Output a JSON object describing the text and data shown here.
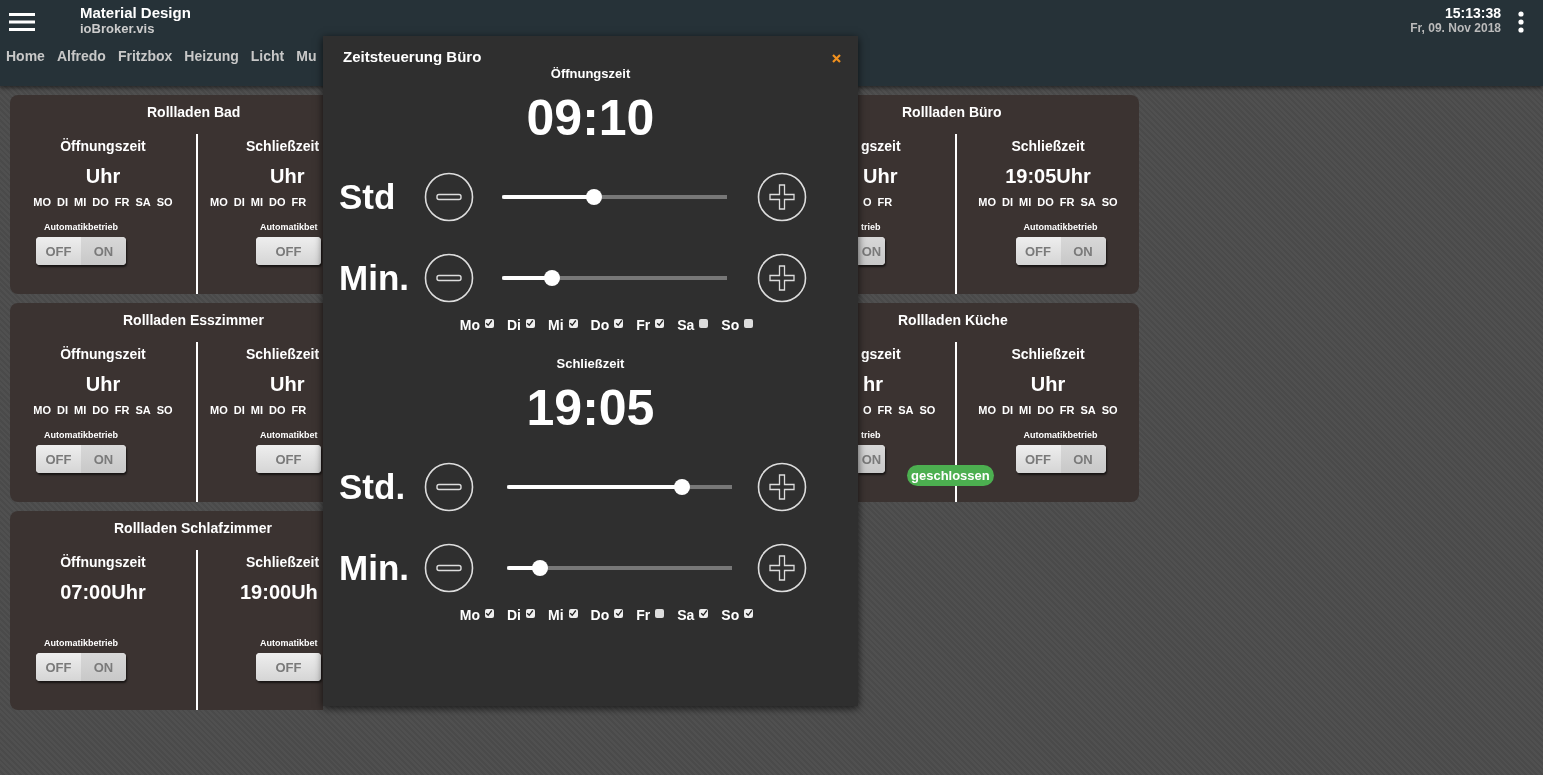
{
  "header": {
    "title": "Material Design",
    "subtitle": "ioBroker.vis",
    "time": "15:13:38",
    "date": "Fr, 09. Nov 2018",
    "nav": [
      {
        "label": "Home",
        "selected": false
      },
      {
        "label": "Alfredo",
        "selected": false
      },
      {
        "label": "Fritzbox",
        "selected": false
      },
      {
        "label": "Heizung",
        "selected": false
      },
      {
        "label": "Licht",
        "selected": false
      },
      {
        "label": "Mu",
        "selected": false
      }
    ]
  },
  "left_cards": [
    {
      "title": "Rollladen Bad",
      "halves": [
        {
          "label": "Öffnungszeit",
          "time": "Uhr",
          "days": [
            "MO",
            "DI",
            "MI",
            "DO",
            "FR",
            "SA",
            "SO"
          ],
          "auto_label": "Automatikbetrieb",
          "switch": [
            "OFF",
            "ON"
          ],
          "on": true
        },
        {
          "label": "Schließzeit",
          "time": "Uhr",
          "days": [
            "MO",
            "DI",
            "MI",
            "DO",
            "FR"
          ],
          "auto_label": "Automatikbet",
          "switch": [
            "OFF"
          ],
          "on": true
        }
      ]
    },
    {
      "title": "Rollladen Esszimmer",
      "halves": [
        {
          "label": "Öffnungszeit",
          "time": "Uhr",
          "days": [
            "MO",
            "DI",
            "MI",
            "DO",
            "FR",
            "SA",
            "SO"
          ],
          "auto_label": "Automatikbetrieb",
          "switch": [
            "OFF",
            "ON"
          ],
          "on": true
        },
        {
          "label": "Schließzeit",
          "time": "Uhr",
          "days": [
            "MO",
            "DI",
            "MI",
            "DO",
            "FR"
          ],
          "auto_label": "Automatikbet",
          "switch": [
            "OFF"
          ],
          "on": true
        }
      ]
    },
    {
      "title": "Rollladen Schlafzimmer",
      "halves": [
        {
          "label": "Öffnungszeit",
          "time": "07:00Uhr",
          "auto_label": "Automatikbetrieb",
          "switch": [
            "OFF",
            "ON"
          ],
          "on": true
        },
        {
          "label": "Schließzeit",
          "time": "19:00Uh",
          "auto_label": "Automatikbet",
          "switch": [
            "OFF"
          ],
          "on": true
        }
      ]
    }
  ],
  "right_cards": [
    {
      "title": "Rollladen Büro",
      "halves": [
        {
          "label": "gszeit",
          "time": "Uhr",
          "days": [
            "O",
            "FR"
          ],
          "auto_label": "trieb",
          "switch": [
            "ON"
          ],
          "on": true
        },
        {
          "label": "Schließzeit",
          "time": "19:05Uhr",
          "days": [
            "MO",
            "DI",
            "MI",
            "DO",
            "FR",
            "SA",
            "SO"
          ],
          "auto_label": "Automatikbetrieb",
          "switch": [
            "OFF",
            "ON"
          ],
          "on": true
        }
      ]
    },
    {
      "title": "Rollladen Küche",
      "badge": "geschlossen",
      "halves": [
        {
          "label": "gszeit",
          "time": "hr",
          "days": [
            "O",
            "FR",
            "SA",
            "SO"
          ],
          "auto_label": "trieb",
          "switch": [
            "ON"
          ],
          "on": true
        },
        {
          "label": "Schließzeit",
          "time": "Uhr",
          "days": [
            "MO",
            "DI",
            "MI",
            "DO",
            "FR",
            "SA",
            "SO"
          ],
          "auto_label": "Automatikbetrieb",
          "switch": [
            "OFF",
            "ON"
          ],
          "on": true
        }
      ]
    }
  ],
  "dialog": {
    "title": "Zeitsteuerung Büro",
    "sections": [
      {
        "label": "Öffnungszeit",
        "time": "09:10",
        "sliders": [
          {
            "label": "Std",
            "level": 0.4
          },
          {
            "label": "Min.",
            "level": 0.2
          }
        ],
        "days": [
          {
            "label": "Mo",
            "checked": true
          },
          {
            "label": "Di",
            "checked": true
          },
          {
            "label": "Mi",
            "checked": true
          },
          {
            "label": "Do",
            "checked": true
          },
          {
            "label": "Fr",
            "checked": true
          },
          {
            "label": "Sa",
            "checked": false
          },
          {
            "label": "So",
            "checked": false
          }
        ]
      },
      {
        "label": "Schließzeit",
        "time": "19:05",
        "sliders": [
          {
            "label": "Std.",
            "level": 0.8
          },
          {
            "label": "Min.",
            "level": 0.12
          }
        ],
        "days": [
          {
            "label": "Mo",
            "checked": true
          },
          {
            "label": "Di",
            "checked": true
          },
          {
            "label": "Mi",
            "checked": true
          },
          {
            "label": "Do",
            "checked": true
          },
          {
            "label": "Fr",
            "checked": false
          },
          {
            "label": "Sa",
            "checked": true
          },
          {
            "label": "So",
            "checked": true
          }
        ]
      }
    ]
  }
}
